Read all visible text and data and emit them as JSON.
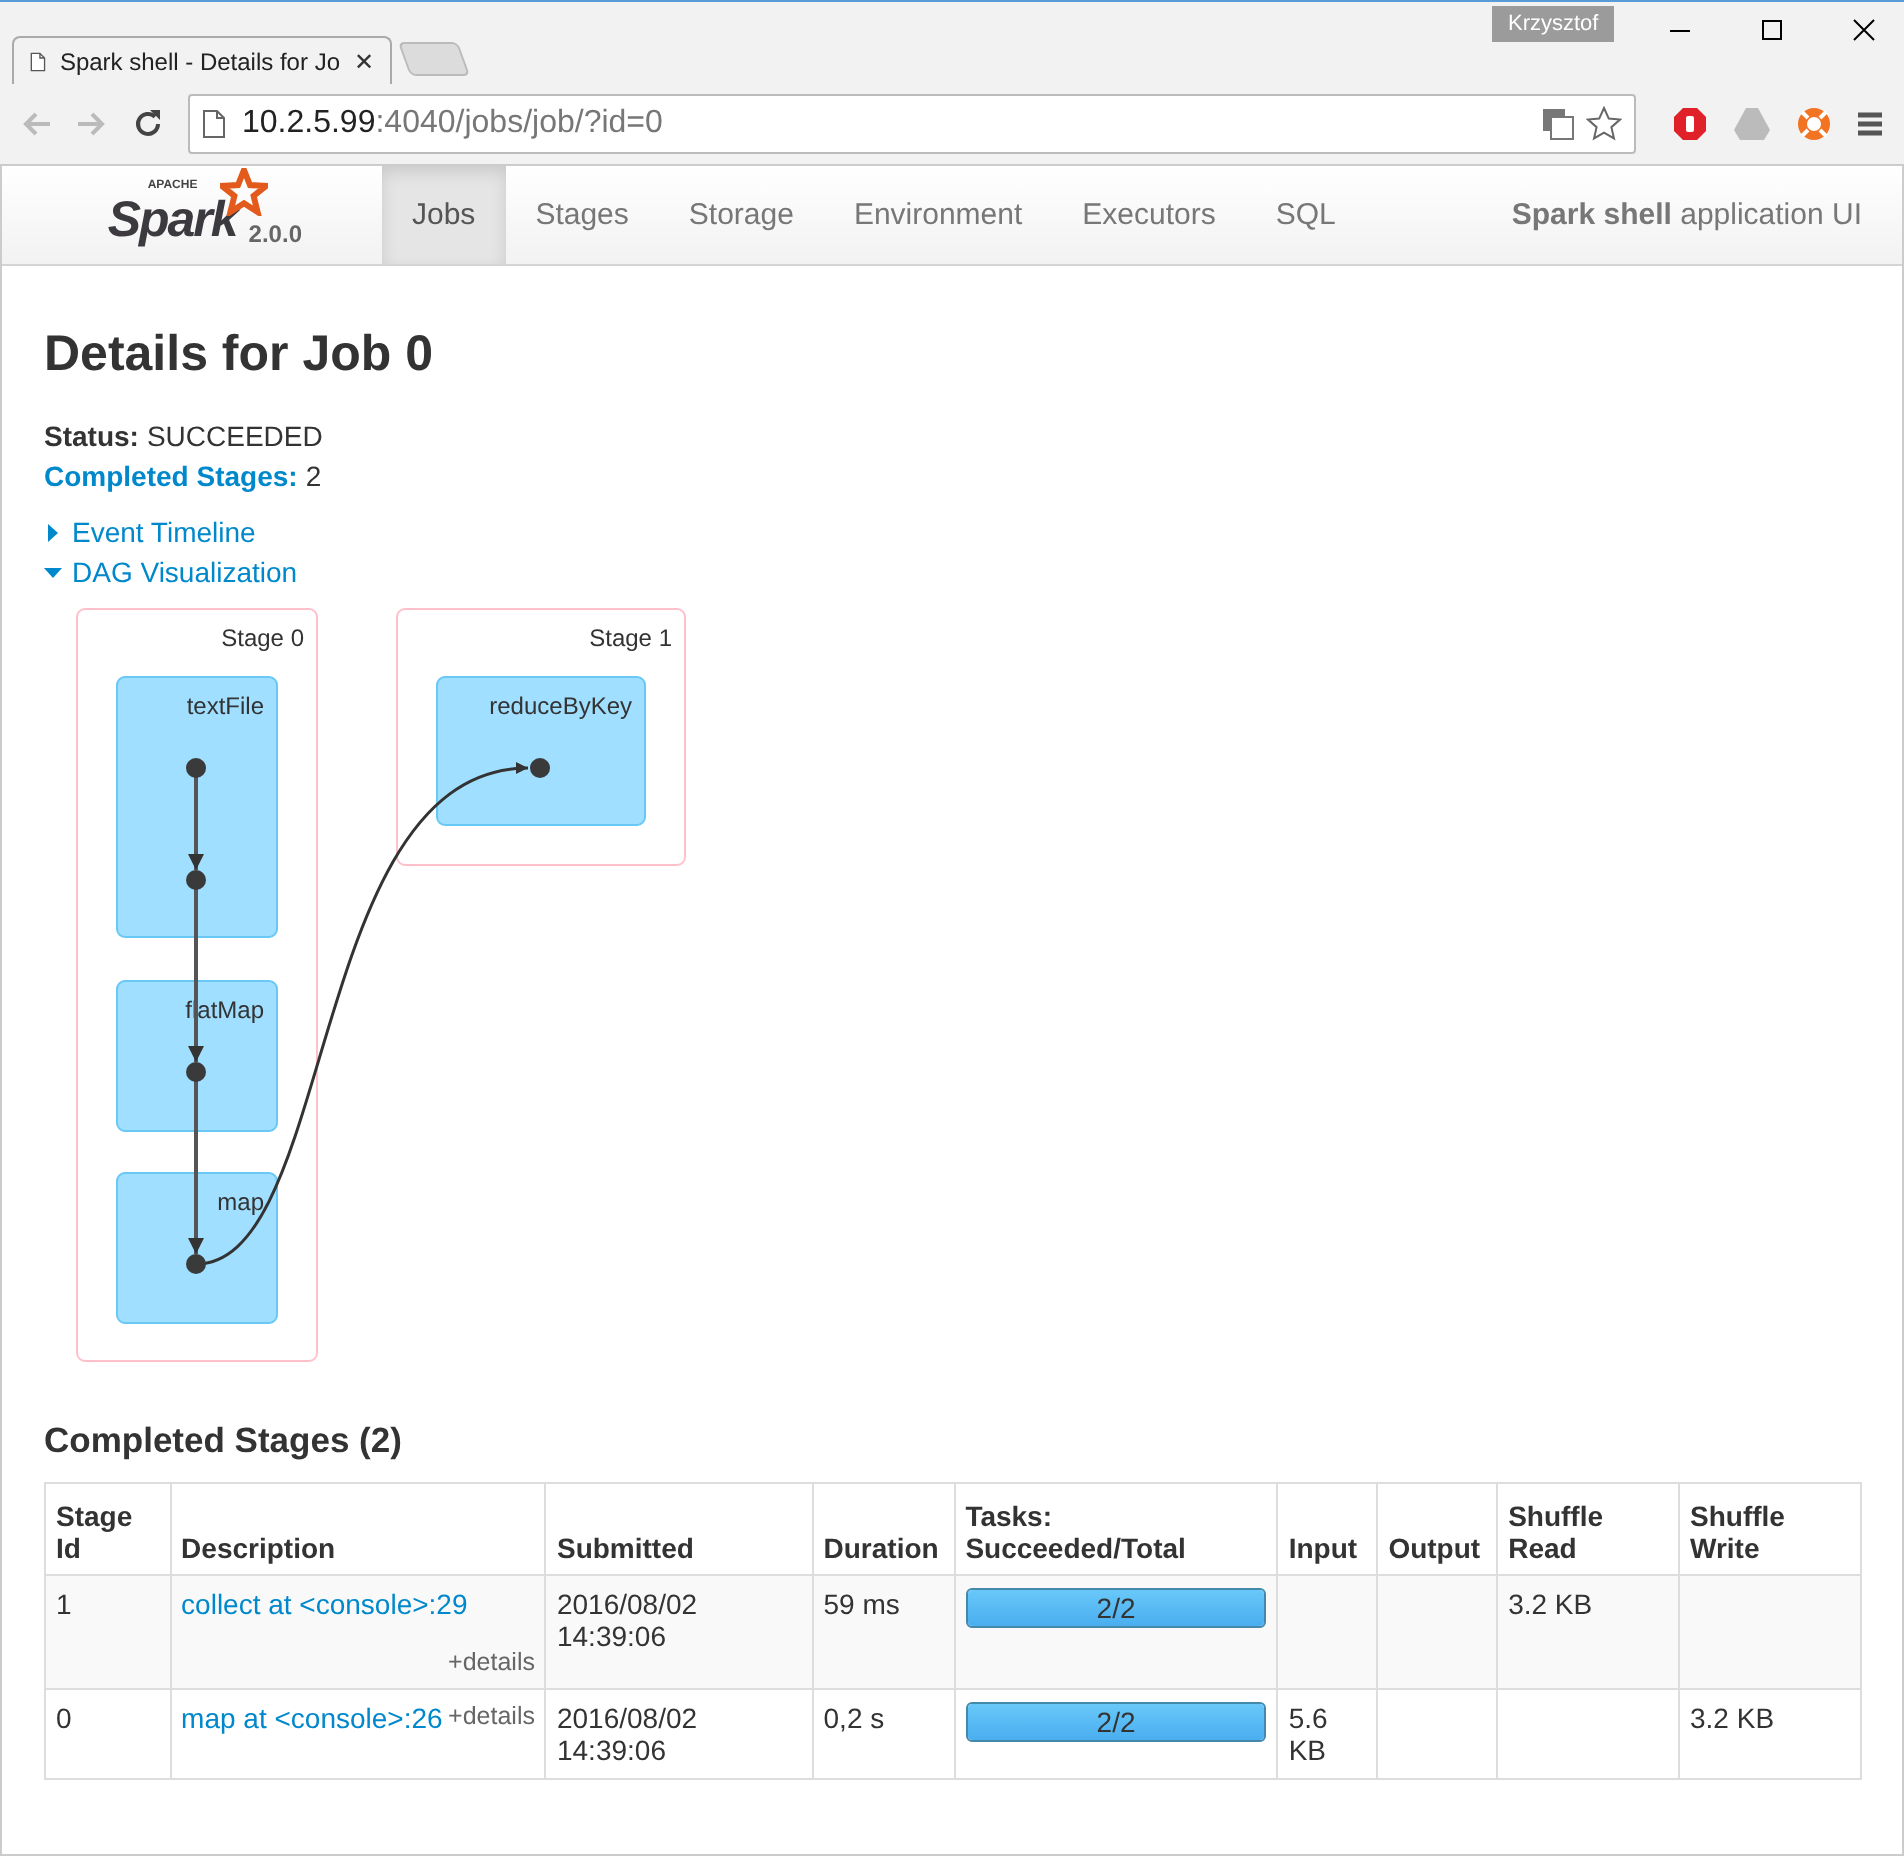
{
  "browser": {
    "tab_title": "Spark shell - Details for Jo",
    "tab_close": "✕",
    "user": "Krzysztof",
    "url_host": "10.2.5.99",
    "url_path": ":4040/jobs/job/?id=0"
  },
  "navbar": {
    "logo_small": "APACHE",
    "logo_name": "Spark",
    "version": "2.0.0",
    "tabs": [
      {
        "label": "Jobs",
        "selected": true
      },
      {
        "label": "Stages",
        "selected": false
      },
      {
        "label": "Storage",
        "selected": false
      },
      {
        "label": "Environment",
        "selected": false
      },
      {
        "label": "Executors",
        "selected": false
      },
      {
        "label": "SQL",
        "selected": false
      }
    ],
    "app_title": "**Spark shell** application UI"
  },
  "title": "Details for Job 0",
  "summary": [
    {
      "label": "Status:",
      "value": "SUCCEEDED",
      "link": false
    },
    {
      "label": "Completed Stages:",
      "value": "2",
      "link": true
    }
  ],
  "toggles": [
    {
      "label": "Event Timeline",
      "expanded": false
    },
    {
      "label": "DAG Visualization",
      "expanded": true
    }
  ],
  "dag": {
    "stages": [
      {
        "label": "Stage 0",
        "rdds": [
          "textFile",
          "flatMap",
          "map"
        ]
      },
      {
        "label": "Stage 1",
        "rdds": [
          "reduceByKey"
        ]
      }
    ]
  },
  "section_title": "Completed Stages (2)",
  "table": {
    "columns": [
      "Stage Id",
      "Description",
      "Submitted",
      "Duration",
      "Tasks: Succeeded/Total",
      "Input",
      "Output",
      "Shuffle Read",
      "Shuffle Write"
    ],
    "rows": [
      {
        "stage_id": "1",
        "description": "collect at <console>:29",
        "details": "+details",
        "submitted": "2016/08/02 14:39:06",
        "duration": "59 ms",
        "tasks": "2/2",
        "level": 1,
        "input": "",
        "output": "",
        "shuffle_read": "3.2 KB",
        "shuffle_write": ""
      },
      {
        "stage_id": "0",
        "description": "map at <console>:26",
        "details": "+details",
        "submitted": "2016/08/02 14:39:06",
        "duration": "0,2 s",
        "tasks": "2/2",
        "level": 1,
        "input": "5.6 KB",
        "output": "",
        "shuffle_read": "",
        "shuffle_write": "3.2 KB"
      }
    ]
  }
}
